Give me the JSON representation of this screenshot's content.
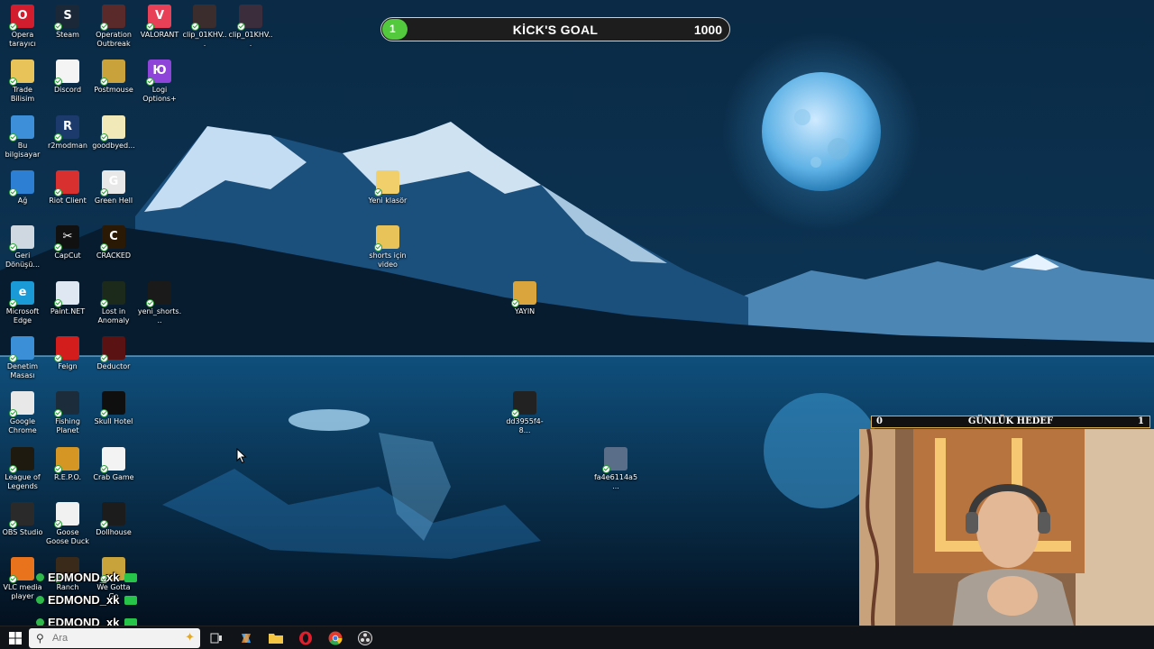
{
  "desktop": {
    "icons": [
      {
        "label": "Opera tarayıcı",
        "icon": "opera-icon",
        "color": "#d11d2d",
        "glyph": "O"
      },
      {
        "label": "Steam",
        "icon": "steam-icon",
        "color": "#1b2838",
        "glyph": "S"
      },
      {
        "label": "Operation Outbreak",
        "icon": "game-shortcut-icon",
        "color": "#5a2a2a",
        "glyph": ""
      },
      {
        "label": "VALORANT",
        "icon": "valorant-icon",
        "color": "#e84057",
        "glyph": "V"
      },
      {
        "label": "clip_01KHV...",
        "icon": "video-file-icon",
        "color": "#3b2d2d",
        "glyph": ""
      },
      {
        "label": "clip_01KHV...",
        "icon": "video-file-icon",
        "color": "#3b2d3b",
        "glyph": ""
      },
      {
        "label": "Trade Bilisim",
        "icon": "folder-icon",
        "color": "#e8c35a",
        "glyph": ""
      },
      {
        "label": "Discord",
        "icon": "document-icon",
        "color": "#f4f4f4",
        "glyph": ""
      },
      {
        "label": "Postmouse",
        "icon": "game-shortcut-icon",
        "color": "#c9a23b",
        "glyph": ""
      },
      {
        "label": "Logi Options+",
        "icon": "logi-options-icon",
        "color": "#8e44d8",
        "glyph": "Ю"
      },
      {
        "label": "Bu bilgisayar",
        "icon": "computer-icon",
        "color": "#3c8fd8",
        "glyph": ""
      },
      {
        "label": "r2modman",
        "icon": "r2modman-icon",
        "color": "#1c3a6b",
        "glyph": "R"
      },
      {
        "label": "goodbyed...",
        "icon": "document-icon",
        "color": "#f1e9b8",
        "glyph": ""
      },
      {
        "label": "Ağ",
        "icon": "network-icon",
        "color": "#2d7fd3",
        "glyph": ""
      },
      {
        "label": "Riot Client",
        "icon": "riot-client-icon",
        "color": "#d8302f",
        "glyph": ""
      },
      {
        "label": "Green Hell",
        "icon": "green-hell-icon",
        "color": "#e8e8e8",
        "glyph": "G"
      },
      {
        "label": "Geri Dönüşü...",
        "icon": "recycle-bin-icon",
        "color": "#cfd8e0",
        "glyph": ""
      },
      {
        "label": "CapCut",
        "icon": "capcut-icon",
        "color": "#111111",
        "glyph": "✂"
      },
      {
        "label": "CRACKED",
        "icon": "cracked-game-icon",
        "color": "#2a1a05",
        "glyph": "C"
      },
      {
        "label": "Microsoft Edge",
        "icon": "edge-icon",
        "color": "#1a9bd8",
        "glyph": "e"
      },
      {
        "label": "Paint.NET",
        "icon": "paintnet-icon",
        "color": "#dfe7f2",
        "glyph": ""
      },
      {
        "label": "Lost in Anomaly",
        "icon": "game-shortcut-icon",
        "color": "#1c2a1c",
        "glyph": ""
      },
      {
        "label": "yeni_shorts...",
        "icon": "video-file-icon",
        "color": "#1a1a1a",
        "glyph": ""
      },
      {
        "label": "Denetim Masası",
        "icon": "control-panel-icon",
        "color": "#3a8fd6",
        "glyph": ""
      },
      {
        "label": "Feign",
        "icon": "feign-icon",
        "color": "#d31c1c",
        "glyph": ""
      },
      {
        "label": "Deductor",
        "icon": "game-shortcut-icon",
        "color": "#5a1212",
        "glyph": ""
      },
      {
        "label": "Google Chrome",
        "icon": "chrome-icon",
        "color": "#e8e8e8",
        "glyph": ""
      },
      {
        "label": "Fishing Planet",
        "icon": "fishing-planet-icon",
        "color": "#1c2c3a",
        "glyph": ""
      },
      {
        "label": "Skull Hotel",
        "icon": "skull-hotel-icon",
        "color": "#0f0f0f",
        "glyph": ""
      },
      {
        "label": "League of Legends",
        "icon": "league-icon",
        "color": "#1f1a10",
        "glyph": ""
      },
      {
        "label": "R.E.P.O.",
        "icon": "repo-icon",
        "color": "#d69624",
        "glyph": ""
      },
      {
        "label": "Crab Game",
        "icon": "crab-game-icon",
        "color": "#f3f3f3",
        "glyph": ""
      },
      {
        "label": "OBS Studio",
        "icon": "obs-icon",
        "color": "#2a2a2a",
        "glyph": ""
      },
      {
        "label": "Goose Goose Duck",
        "icon": "goose-icon",
        "color": "#f1f1f1",
        "glyph": ""
      },
      {
        "label": "Dollhouse",
        "icon": "game-shortcut-icon",
        "color": "#1c1c1c",
        "glyph": ""
      },
      {
        "label": "VLC media player",
        "icon": "vlc-icon",
        "color": "#e8731c",
        "glyph": ""
      },
      {
        "label": "Ranch",
        "icon": "game-shortcut-icon",
        "color": "#3a2a1a",
        "glyph": ""
      },
      {
        "label": "We Gotta Go",
        "icon": "game-shortcut-icon",
        "color": "#c8a23b",
        "glyph": ""
      },
      {
        "label": "Yeni klasör",
        "icon": "folder-icon",
        "color": "#f1cf6b",
        "glyph": ""
      },
      {
        "label": "shorts için video",
        "icon": "folder-icon",
        "color": "#e8c35a",
        "glyph": ""
      },
      {
        "label": "YAYIN",
        "icon": "folder-icon",
        "color": "#d9a53c",
        "glyph": ""
      },
      {
        "label": "dd3955f4-8...",
        "icon": "file-icon",
        "color": "#222222",
        "glyph": ""
      },
      {
        "label": "fa4e6114a5...",
        "icon": "image-file-icon",
        "color": "#5a6e8a",
        "glyph": ""
      }
    ]
  },
  "stream_goal": {
    "current": "1",
    "title": "KİCK'S GOAL",
    "target": "1000",
    "progress_fraction": 0.001,
    "fill_color": "#53c93e"
  },
  "daily_goal": {
    "min": "0",
    "title": "GÜNLÜK HEDEF",
    "max": "1"
  },
  "chat": {
    "messages": [
      {
        "user": "EDMOND_xk"
      },
      {
        "user": "EDMOND_xk"
      },
      {
        "user": "EDMOND_xk"
      }
    ]
  },
  "taskbar": {
    "search_placeholder": "Ara",
    "apps": [
      "start-icon",
      "task-view-icon",
      "copilot-icon",
      "file-explorer-icon",
      "opera-icon",
      "chrome-icon",
      "obs-icon"
    ]
  }
}
